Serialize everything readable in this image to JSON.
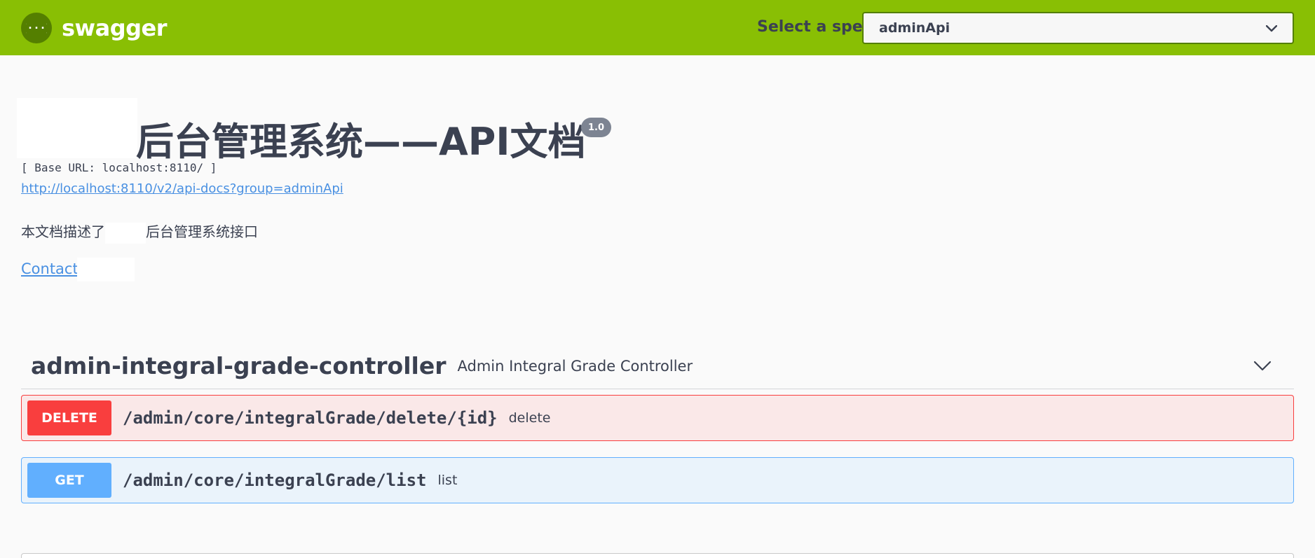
{
  "topbar": {
    "logo_text": "swagger",
    "logo_icon": "swagger-braces-icon",
    "spec_label": "Select a spec",
    "spec_selected": "adminApi",
    "brand_color": "#89bf04"
  },
  "info": {
    "title": "后台管理系统——API文档",
    "version": "1.0",
    "base_url": "[ Base URL: localhost:8110/ ]",
    "spec_link": "http://localhost:8110/v2/api-docs?group=adminApi",
    "description_prefix": "本文档描述了",
    "description_suffix": "后台管理系统接口",
    "contact_label": "Contact"
  },
  "tags": [
    {
      "name": "admin-integral-grade-controller",
      "description": "Admin Integral Grade Controller",
      "toggle_icon": "chevron-down-icon",
      "operations": [
        {
          "method": "DELETE",
          "path": "/admin/core/integralGrade/delete/{id}",
          "summary": "delete",
          "color": "#f93e3e"
        },
        {
          "method": "GET",
          "path": "/admin/core/integralGrade/list",
          "summary": "list",
          "color": "#61affe"
        }
      ]
    }
  ]
}
